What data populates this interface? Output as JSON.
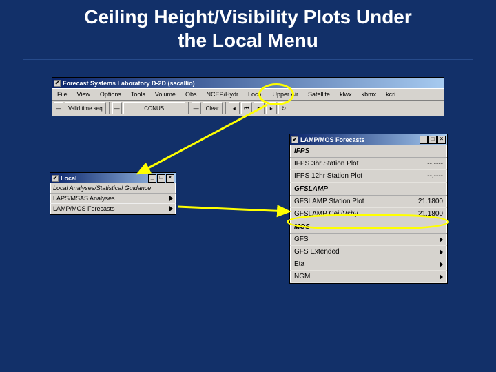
{
  "title_line1": "Ceiling Height/Visibility Plots Under",
  "title_line2": "the Local Menu",
  "main_window": {
    "title": "Forecast Systems Laboratory D-2D (sscallio)",
    "menus": [
      "File",
      "View",
      "Options",
      "Tools",
      "Volume",
      "Obs",
      "NCEP/Hydr",
      "Local",
      "Upper Air",
      "Satellite",
      "klwx",
      "kbmx",
      "kcri"
    ],
    "toolbar": {
      "valid_label": "Valid time seq",
      "conus": "CONUS",
      "clear": "Clear"
    }
  },
  "local_menu": {
    "title": "Local",
    "heading": "Local Analyses/Statistical Guidance",
    "items": [
      "LAPS/MSAS Analyses",
      "LAMP/MOS Forecasts"
    ]
  },
  "lampmos": {
    "title": "LAMP/MOS Forecasts",
    "sections": {
      "ifps": {
        "heading": "IFPS",
        "rows": [
          {
            "label": "IFPS 3hr Station Plot",
            "value": "--.----"
          },
          {
            "label": "IFPS 12hr Station Plot",
            "value": "--.----"
          }
        ]
      },
      "gfslamp": {
        "heading": "GFSLAMP",
        "rows": [
          {
            "label": "GFSLAMP Station Plot",
            "value": "21.1800"
          },
          {
            "label": "GFSLAMP Ceil/Vsby",
            "value": "21.1800"
          }
        ]
      },
      "mos": {
        "heading": "MOS",
        "rows": [
          "GFS",
          "GFS Extended",
          "Eta",
          "NGM"
        ]
      }
    }
  }
}
